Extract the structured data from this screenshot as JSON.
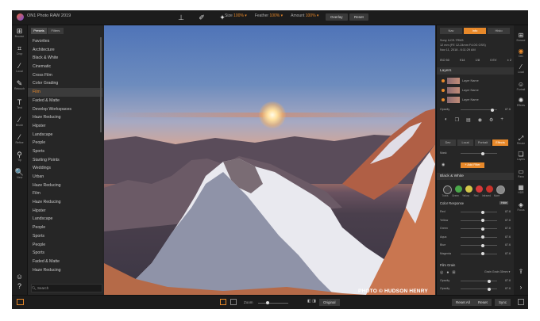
{
  "window": {
    "title": "ON1 Photo RAW 2019"
  },
  "toolbar": {
    "size_label": "Size",
    "size_value": "100% ▾",
    "feather_label": "Feather",
    "feather_value": "100% ▾",
    "amount_label": "Amount",
    "amount_value": "100% ▾",
    "overlay_label": "Overlay",
    "reset_label": "Reset"
  },
  "left_rail": [
    {
      "icon": "browse-icon",
      "glyph": "⊞",
      "label": "Browse"
    },
    {
      "icon": "crop-icon",
      "glyph": "⌗",
      "label": "Crop"
    },
    {
      "icon": "local-icon",
      "glyph": "⁄",
      "label": "Local"
    },
    {
      "icon": "retouch-icon",
      "glyph": "✎",
      "label": "Retouch"
    },
    {
      "icon": "text-icon",
      "glyph": "T",
      "label": "Text"
    },
    {
      "icon": "brush-icon",
      "glyph": "⁄",
      "label": "Brush"
    },
    {
      "icon": "refine-icon",
      "glyph": "⁄",
      "label": "Refine"
    },
    {
      "icon": "pin-icon",
      "glyph": "⚲",
      "label": "Tip"
    },
    {
      "icon": "view-icon",
      "glyph": "🔍",
      "label": "View"
    }
  ],
  "presets": {
    "tab_presets": "Presets",
    "tab_filters": "Filters",
    "selected": "Film",
    "items": [
      "Favorites",
      "Architecture",
      "Black & White",
      "Cinematic",
      "Cross Film",
      "Color Grading",
      "Film",
      "Faded & Matte",
      "Develop Workspaces",
      "Haze Reducing",
      "Hipster",
      "Landscape",
      "People",
      "Sports",
      "Starting Points",
      "Weddings",
      "Urban",
      "Haze Reducing",
      "Film",
      "Haze Reducing",
      "Hipster",
      "Landscape",
      "People",
      "Sports",
      "People",
      "Sports",
      "Faded & Matte",
      "Haze Reducing"
    ],
    "search_placeholder": "Search"
  },
  "photo": {
    "watermark": "PHOTO © HUDSON HENRY"
  },
  "right_panel": {
    "tab_nav": "Nav",
    "tab_info": "Info",
    "tab_histo": "Histo",
    "info_lines": [
      "Sony ILCE-7RM3",
      "12 mm (FE 12-24mm F4.0G OSS)",
      "Nov 11, 2018 - 6:11:29 AM"
    ],
    "exif": [
      "ISO 50",
      "f/14",
      "1/8",
      "0 EV",
      "± 2"
    ],
    "layers_title": "Layers",
    "layer_name": "Layer Name",
    "opacity_label": "Opacity",
    "opacity_value": "87.6",
    "develop_tabs": [
      "Dev",
      "Local",
      "Portrait",
      "Effects"
    ],
    "mask_label": "Mask",
    "density_label": "Density",
    "add_filter": "+ Add Filter",
    "filter_title": "Black & White",
    "swatch_labels": [
      "Trans",
      "Green",
      "Yellow",
      "Red",
      "Infrared",
      "More"
    ],
    "swatch_colors": [
      "#3a3a3a",
      "#4aa84a",
      "#d6c84a",
      "#d63a3a",
      "#c8322a",
      "#888888"
    ],
    "color_response_title": "Color Response",
    "color_response_badge": "Hide",
    "color_rows": [
      {
        "name": "Red",
        "value": "87.6"
      },
      {
        "name": "Yellow",
        "value": "87.6"
      },
      {
        "name": "Green",
        "value": "87.6"
      },
      {
        "name": "Aqua",
        "value": "87.6"
      },
      {
        "name": "Blue",
        "value": "87.6"
      },
      {
        "name": "Magenta",
        "value": "87.6"
      }
    ],
    "film_grain_title": "Film Grain",
    "grain_label": "Grain",
    "grain_value": "Grain 35mm",
    "grain_rows": [
      {
        "name": "Opacity",
        "value": "87.6"
      },
      {
        "name": "Opacity",
        "value": "87.6"
      }
    ]
  },
  "right_rail": [
    {
      "icon": "browse-right-icon",
      "glyph": "⊞",
      "label": "Browse"
    },
    {
      "icon": "develop-icon",
      "glyph": "◉",
      "label": "Dev",
      "active": true
    },
    {
      "icon": "local-right-icon",
      "glyph": "⁄",
      "label": "Local"
    },
    {
      "icon": "portrait-icon",
      "glyph": "☺",
      "label": "Portrait"
    },
    {
      "icon": "effects-icon",
      "glyph": "✺",
      "label": "Effects"
    },
    {
      "icon": "resize-icon",
      "glyph": "⤢",
      "label": "Resize"
    },
    {
      "icon": "layers-icon",
      "glyph": "❏",
      "label": "Layers"
    },
    {
      "icon": "pano-icon",
      "glyph": "▭",
      "label": "Pano"
    },
    {
      "icon": "hdr-icon",
      "glyph": "▦",
      "label": "HDR"
    },
    {
      "icon": "focus-icon",
      "glyph": "◈",
      "label": "Focus"
    }
  ],
  "bottom": {
    "zoom_label": "Zoom",
    "original_label": "Original",
    "reset_all": "Reset All",
    "reset": "Reset",
    "sync": "Sync"
  },
  "colors": {
    "accent": "#e8892a",
    "bg": "#242424"
  }
}
